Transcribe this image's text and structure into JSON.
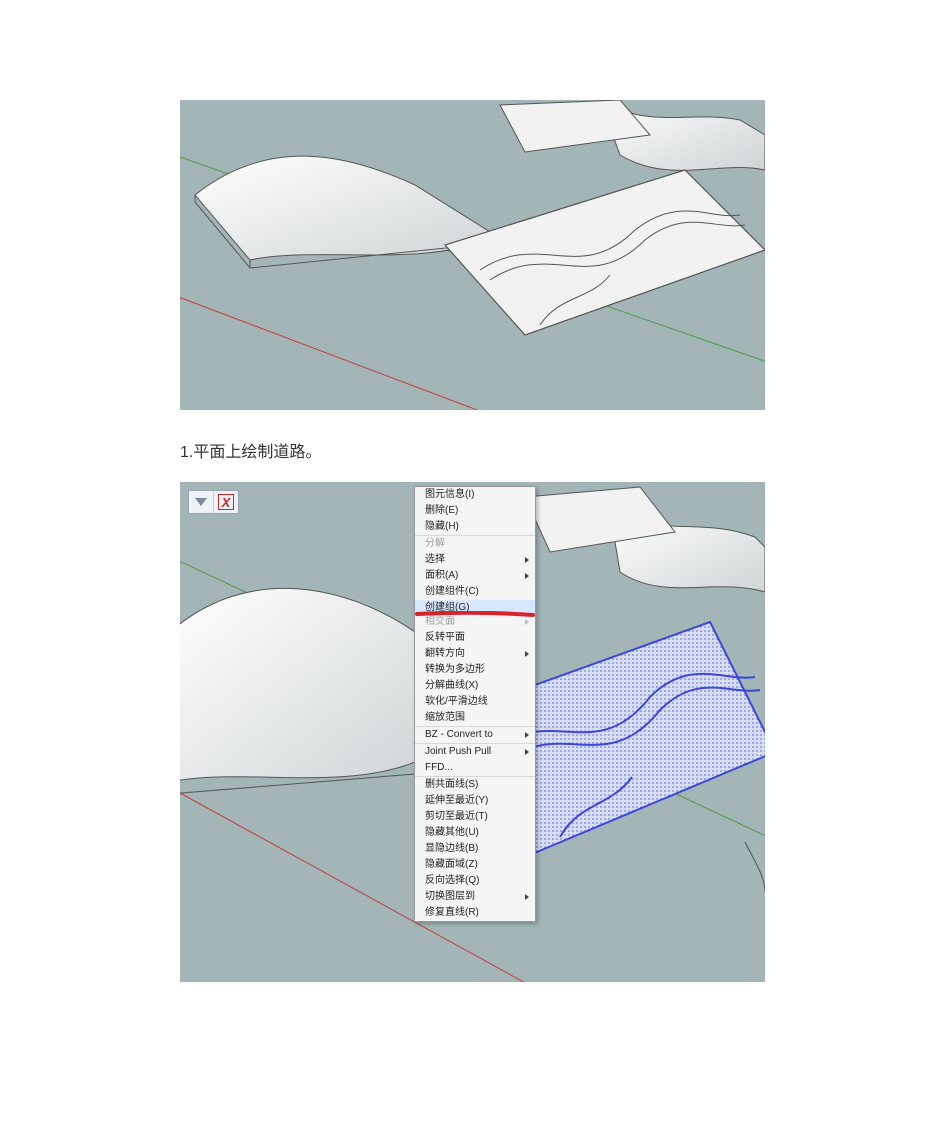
{
  "caption1": "1.平面上绘制道路。",
  "toolbar": {
    "icon1": "bucket-icon",
    "icon2": "close-icon"
  },
  "menu": {
    "items": [
      {
        "label": "图元信息(I)",
        "sub": false
      },
      {
        "label": "删除(E)",
        "sub": false
      },
      {
        "label": "隐藏(H)",
        "sub": false,
        "sep": true
      },
      {
        "label": "分解",
        "sub": false,
        "dis": true
      },
      {
        "label": "选择",
        "sub": true
      },
      {
        "label": "面积(A)",
        "sub": true
      },
      {
        "label": "创建组件(C)",
        "sub": false
      },
      {
        "label": "创建组(G)",
        "sub": false,
        "hl": true,
        "underline": true
      },
      {
        "label": "相交面",
        "sub": true,
        "dis": true
      },
      {
        "label": "反转平面",
        "sub": false
      },
      {
        "label": "翻转方向",
        "sub": true
      },
      {
        "label": "转换为多边形",
        "sub": false
      },
      {
        "label": "分解曲线(X)",
        "sub": false
      },
      {
        "label": "软化/平滑边线",
        "sub": false
      },
      {
        "label": "缩放范围",
        "sub": false,
        "sep": true
      },
      {
        "label": "BZ - Convert to",
        "sub": true,
        "sep": true
      },
      {
        "label": "Joint Push Pull",
        "sub": true
      },
      {
        "label": "FFD...",
        "sub": false,
        "sep": true
      },
      {
        "label": "删共面线(S)",
        "sub": false
      },
      {
        "label": "延伸至最近(Y)",
        "sub": false
      },
      {
        "label": "剪切至最近(T)",
        "sub": false
      },
      {
        "label": "隐藏其他(U)",
        "sub": false
      },
      {
        "label": "显隐边线(B)",
        "sub": false
      },
      {
        "label": "隐藏面域(Z)",
        "sub": false
      },
      {
        "label": "反向选择(Q)",
        "sub": false
      },
      {
        "label": "切换图层到",
        "sub": true
      },
      {
        "label": "修复直线(R)",
        "sub": false
      }
    ]
  }
}
